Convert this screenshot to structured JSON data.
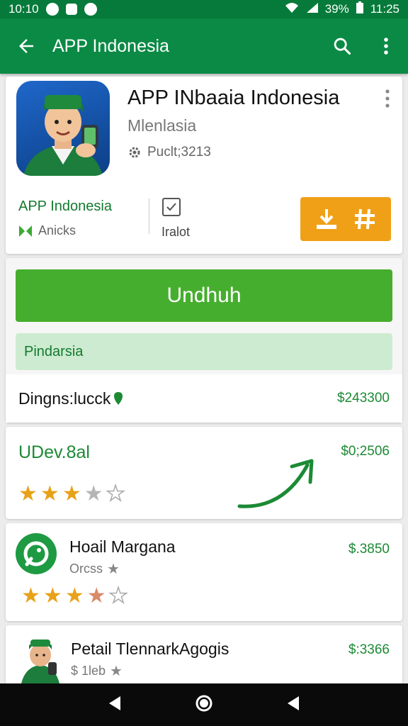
{
  "status_bar": {
    "time": "10:10",
    "battery": "39%",
    "clock_right": "11:25"
  },
  "app_bar": {
    "title": "APP Indonesia"
  },
  "app_card": {
    "title": "APP INbaaia Indonesia",
    "subtitle": "Mlenlasia",
    "publisher": "Puclt;3213",
    "meta_left_title": "APP Indonesia",
    "meta_left_sub": "Anicks",
    "meta_mid_label": "Iralot"
  },
  "action": {
    "install_label": "Undhuh",
    "info_label": "Pindarsia",
    "row_name": "Dingns:lucck",
    "row_price": "$243300"
  },
  "rating_card": {
    "title": "UDev.8al",
    "price": "$0;2506",
    "rating": 3.5
  },
  "list_items": [
    {
      "title": "Hoail Margana",
      "sub": "Orcss",
      "price": "$.3850",
      "rating": 3.5
    },
    {
      "title": "Petail TlennarkAgogis",
      "sub": "$ 1leb",
      "price": "$:3366"
    }
  ],
  "colors": {
    "app_bar": "#0b8a45",
    "status_bar": "#067a3a",
    "install": "#46ae2e",
    "accent_orange": "#f0a017",
    "star": "#e8a21a"
  }
}
